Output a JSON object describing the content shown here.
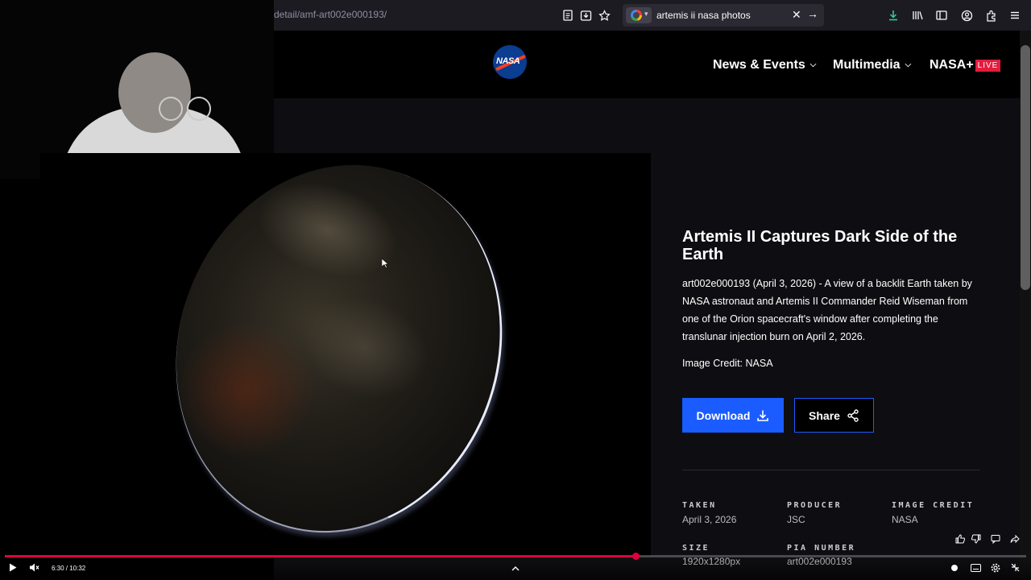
{
  "browser": {
    "url_fragment": "detail/amf-art002e000193/",
    "search_query": "artemis ii nasa photos"
  },
  "header": {
    "logo_text": "NASA",
    "nav": [
      {
        "label": "News & Events"
      },
      {
        "label": "Multimedia"
      },
      {
        "label": "NASA+"
      }
    ],
    "live_badge": "LIVE"
  },
  "detail": {
    "title": "Artemis II Captures Dark Side of the Earth",
    "description": "art002e000193 (April 3, 2026) - A view of a backlit Earth taken by NASA astronaut and Artemis II Commander Reid Wiseman from one of the Orion spacecraft's window after completing the translunar injection burn on April 2, 2026.",
    "credit_line": "Image Credit: NASA",
    "download_label": "Download",
    "share_label": "Share"
  },
  "metadata": [
    {
      "label": "TAKEN",
      "value": "April 3, 2026"
    },
    {
      "label": "PRODUCER",
      "value": "JSC"
    },
    {
      "label": "IMAGE CREDIT",
      "value": "NASA"
    },
    {
      "label": "SIZE",
      "value": "1920x1280px"
    },
    {
      "label": "PIA NUMBER",
      "value": "art002e000193"
    }
  ],
  "player": {
    "time": "6:30 / 10:32",
    "progress_fraction": 0.617
  },
  "colors": {
    "accent_blue": "#1a5cff",
    "live_red": "#e31c3d",
    "progress_red": "#e0003c"
  }
}
